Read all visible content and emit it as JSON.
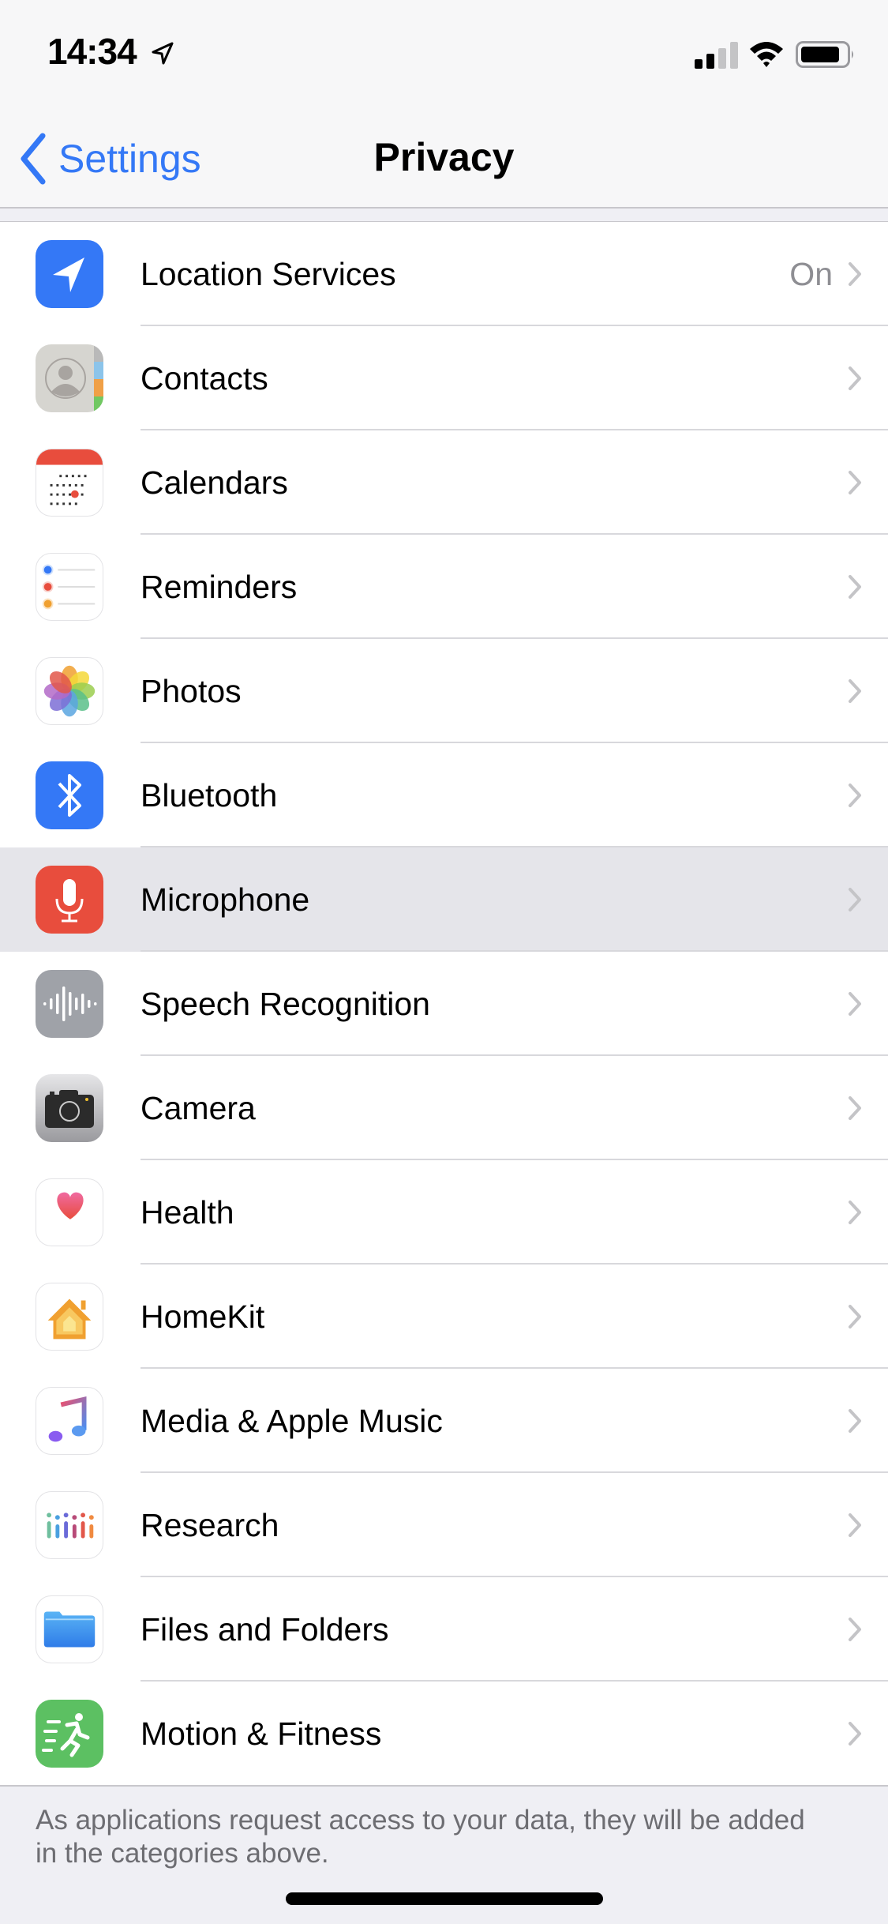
{
  "status_bar": {
    "time": "14:34",
    "location_active": true,
    "signal_bars_active": 2,
    "signal_bars_total": 4,
    "wifi": "connected",
    "battery_percent": 85
  },
  "nav": {
    "back_label": "Settings",
    "title": "Privacy"
  },
  "items": [
    {
      "label": "Location Services",
      "value": "On",
      "icon": "location-services-icon",
      "highlighted": false
    },
    {
      "label": "Contacts",
      "value": "",
      "icon": "contacts-icon",
      "highlighted": false
    },
    {
      "label": "Calendars",
      "value": "",
      "icon": "calendars-icon",
      "highlighted": false
    },
    {
      "label": "Reminders",
      "value": "",
      "icon": "reminders-icon",
      "highlighted": false
    },
    {
      "label": "Photos",
      "value": "",
      "icon": "photos-icon",
      "highlighted": false
    },
    {
      "label": "Bluetooth",
      "value": "",
      "icon": "bluetooth-icon",
      "highlighted": false
    },
    {
      "label": "Microphone",
      "value": "",
      "icon": "microphone-icon",
      "highlighted": true
    },
    {
      "label": "Speech Recognition",
      "value": "",
      "icon": "speech-recognition-icon",
      "highlighted": false
    },
    {
      "label": "Camera",
      "value": "",
      "icon": "camera-icon",
      "highlighted": false
    },
    {
      "label": "Health",
      "value": "",
      "icon": "health-icon",
      "highlighted": false
    },
    {
      "label": "HomeKit",
      "value": "",
      "icon": "homekit-icon",
      "highlighted": false
    },
    {
      "label": "Media & Apple Music",
      "value": "",
      "icon": "media-apple-music-icon",
      "highlighted": false
    },
    {
      "label": "Research",
      "value": "",
      "icon": "research-icon",
      "highlighted": false
    },
    {
      "label": "Files and Folders",
      "value": "",
      "icon": "files-folders-icon",
      "highlighted": false
    },
    {
      "label": "Motion & Fitness",
      "value": "",
      "icon": "motion-fitness-icon",
      "highlighted": false
    }
  ],
  "footer": {
    "text": "As applications request access to your data, they will be added in the categories above."
  },
  "colors": {
    "accent": "#3478f6",
    "highlight_row": "#e5e5ea",
    "secondary_text": "#8e8e93",
    "footer_text": "#6d6d72",
    "background": "#efeff4"
  }
}
